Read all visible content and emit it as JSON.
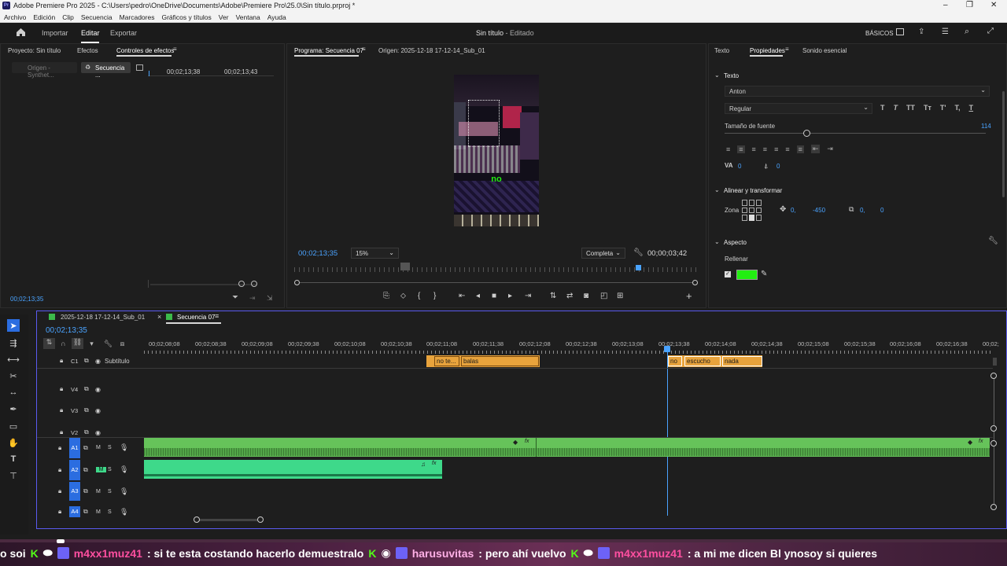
{
  "title_bar": {
    "text": "Adobe Premiere Pro 2025 - C:\\Users\\pedro\\OneDrive\\Documents\\Adobe\\Premiere Pro\\25.0\\Sin título.prproj *"
  },
  "menu": [
    "Archivo",
    "Edición",
    "Clip",
    "Secuencia",
    "Marcadores",
    "Gráficos y títulos",
    "Ver",
    "Ventana",
    "Ayuda"
  ],
  "header": {
    "import": "Importar",
    "edit": "Editar",
    "export": "Exportar",
    "center_title": "Sin título",
    "center_status": "- Editado",
    "workspace": "BÁSICOS"
  },
  "left_panel": {
    "tabs": [
      "Proyecto: Sin título",
      "Efectos",
      "Controles de efectos"
    ],
    "source_tab": "Origen - Synthet...",
    "seq_tab": "Secuencia ...",
    "time_a": "00;02;13;38",
    "time_b": "00;02;13;43",
    "timecode": "00;02;13;35"
  },
  "program": {
    "tab": "Programa: Secuencia 07",
    "source_tab": "Origen: 2025-12-18 17-12-14_Sub_01",
    "caption": "no",
    "timecode": "00;02;13;35",
    "zoom": "15%",
    "quality": "Completa",
    "duration": "00;00;03;42"
  },
  "right_panel": {
    "tabs": [
      "Texto",
      "Propiedades",
      "Sonido esencial"
    ],
    "section_text": "Texto",
    "font": "Anton",
    "style": "Regular",
    "size_label": "Tamaño de fuente",
    "size_value": "114",
    "size_fraction": 0.3,
    "tracking_value": "0",
    "leading_value": "0",
    "section_align": "Alinear y transformar",
    "zone_label": "Zona",
    "pos_x": "0,",
    "pos_y": "-450",
    "scale_x": "0,",
    "scale_y": "0",
    "section_aspect": "Aspecto",
    "fill_label": "Rellenar",
    "fill_color": "#22ee11"
  },
  "timeline": {
    "tabs": [
      "2025-12-18 17-12-14_Sub_01",
      "Secuencia 07"
    ],
    "timecode": "00;02;13;35",
    "ruler": [
      "00;02;08;08",
      "00;02;08;38",
      "00;02;09;08",
      "00;02;09;38",
      "00;02;10;08",
      "00;02;10;38",
      "00;02;11;08",
      "00;02;11;38",
      "00;02;12;08",
      "00;02;12;38",
      "00;02;13;08",
      "00;02;13;38",
      "00;02;14;08",
      "00;02;14;38",
      "00;02;15;08",
      "00;02;15;38",
      "00;02;16;08",
      "00;02;16;38",
      "00;02;"
    ],
    "tracks": {
      "c1": "C1",
      "c1_name": "Subtítulo",
      "v4": "V4",
      "v3": "V3",
      "v2": "V2",
      "a1": "A1",
      "a2": "A2",
      "a3": "A3",
      "a4": "A4",
      "m": "M",
      "s": "S"
    },
    "captions": [
      "no te...",
      "balas",
      "no",
      "escucho",
      "nada"
    ],
    "fx": "fx"
  },
  "chat": {
    "lead": "o soi",
    "u1": "m4xx1muz41",
    "m1": ": si te esta costando hacerlo demuestralo",
    "u2": "harusuvitas",
    "m2": ": pero ahí vuelvo",
    "u3": "m4xx1muz41",
    "m3": ": a mi me dicen Bl ynosoy si quieres"
  },
  "colors": {
    "accent": "#4aa3ff",
    "caption_clip": "#e8a33c",
    "audio_a1": "#66c35a",
    "audio_a2": "#3ed98a",
    "fill": "#22ee11"
  }
}
